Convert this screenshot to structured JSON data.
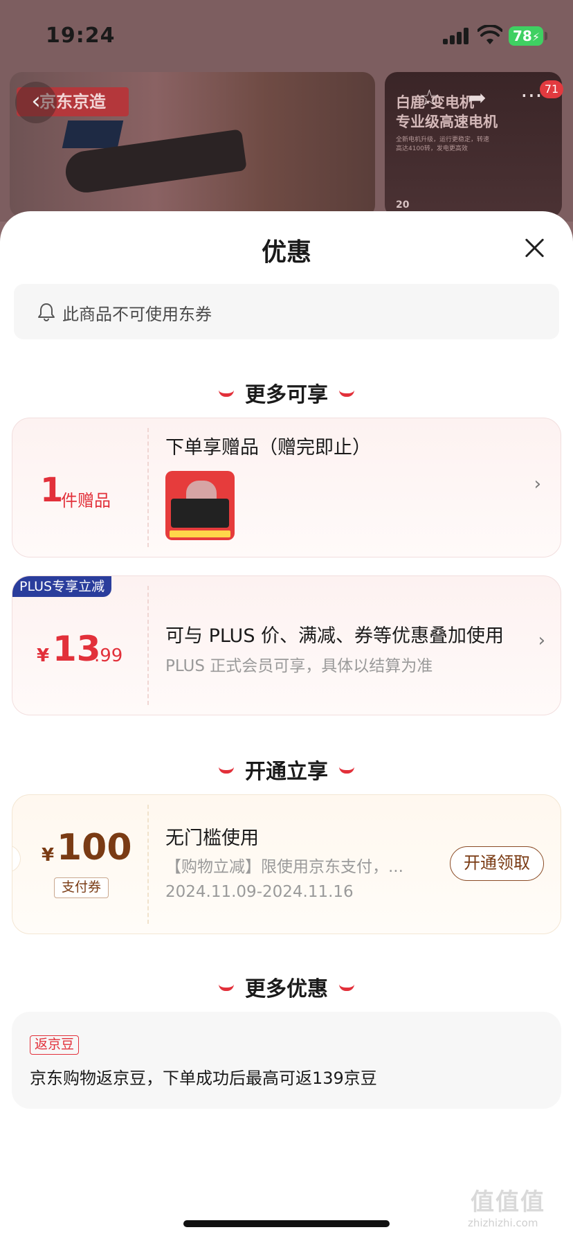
{
  "status": {
    "time": "19:24",
    "battery": "78"
  },
  "background": {
    "brand": "京东京造",
    "right_title_1": "白鹿·变电机",
    "right_title_2": "专业级高速电机",
    "right_sub": "全新电机升级，运行更稳定，转速高达4100转，发电更高效",
    "right_badge": "20",
    "cart_count": "71"
  },
  "sheet": {
    "title": "优惠",
    "notice": "此商品不可使用东券"
  },
  "sections": {
    "more_enjoy": "更多可享",
    "open_enjoy": "开通立享",
    "more_offers": "更多优惠"
  },
  "gift_card": {
    "count": "1",
    "unit": "件赠品",
    "title": "下单享赠品（赠完即止）"
  },
  "plus_card": {
    "tag": "PLUS专享立减",
    "currency": "¥",
    "price_int": "13",
    "price_dec": ".99",
    "title": "可与 PLUS 价、满减、券等优惠叠加使用",
    "subtitle": "PLUS 正式会员可享，具体以结算为准"
  },
  "coupon_card": {
    "currency": "¥",
    "amount": "100",
    "tag": "支付券",
    "title": "无门槛使用",
    "desc": "【购物立减】限使用京东支付，...",
    "date": "2024.11.09-2024.11.16",
    "button": "开通领取"
  },
  "bean_card": {
    "tag": "返京豆",
    "text": "京东购物返京豆，下单成功后最高可返139京豆"
  },
  "watermark": {
    "main": "值值值",
    "sub": "zhizhizhi.com"
  }
}
